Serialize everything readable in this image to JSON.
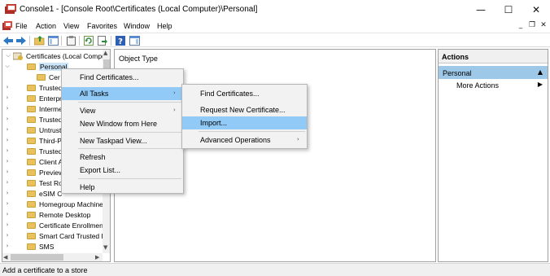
{
  "window": {
    "title": "Console1 - [Console Root\\Certificates (Local Computer)\\Personal]",
    "minimize_glyph": "—",
    "maximize_glyph": "☐",
    "close_glyph": "✕"
  },
  "menubar": {
    "items": [
      "File",
      "Action",
      "View",
      "Favorites",
      "Window",
      "Help"
    ],
    "mdi_minimize": "_",
    "mdi_restore": "❐",
    "mdi_close": "✕"
  },
  "toolbar": {
    "icons": [
      "back-arrow-icon",
      "forward-arrow-icon",
      "up-folder-icon",
      "show-hide-tree-icon",
      "clipboard-icon",
      "refresh-icon",
      "export-list-icon",
      "help-icon",
      "show-hide-action-pane-icon"
    ]
  },
  "tree": {
    "root": "Certificates (Local Compu",
    "items": [
      {
        "label": "Personal",
        "expander": "v",
        "level": 1,
        "selected": true
      },
      {
        "label": "Cer",
        "expander": "",
        "level": 2,
        "selected": false
      },
      {
        "label": "Trusted",
        "expander": ">",
        "level": 1
      },
      {
        "label": "Enterpr",
        "expander": ">",
        "level": 1
      },
      {
        "label": "Interme",
        "expander": ">",
        "level": 1
      },
      {
        "label": "Trusted",
        "expander": ">",
        "level": 1
      },
      {
        "label": "Untrust",
        "expander": ">",
        "level": 1
      },
      {
        "label": "Third-P",
        "expander": ">",
        "level": 1
      },
      {
        "label": "Trusted",
        "expander": ">",
        "level": 1
      },
      {
        "label": "Client A",
        "expander": ">",
        "level": 1
      },
      {
        "label": "Preview",
        "expander": ">",
        "level": 1
      },
      {
        "label": "Test Ro",
        "expander": ">",
        "level": 1
      },
      {
        "label": "eSIM C",
        "expander": ">",
        "level": 1
      },
      {
        "label": "Homegroup Machine",
        "expander": ">",
        "level": 1
      },
      {
        "label": "Remote Desktop",
        "expander": ">",
        "level": 1
      },
      {
        "label": "Certificate Enrollmen",
        "expander": ">",
        "level": 1
      },
      {
        "label": "Smart Card Trusted R",
        "expander": ">",
        "level": 1
      },
      {
        "label": "SMS",
        "expander": ">",
        "level": 1
      }
    ]
  },
  "center": {
    "column_header": "Object Type"
  },
  "actions": {
    "title": "Actions",
    "section": "Personal",
    "section_caret": "▲",
    "item": "More Actions",
    "item_arrow": "▶"
  },
  "context_menu": {
    "items": [
      {
        "label": "Find Certificates...",
        "submenu": false,
        "highlighted": false
      },
      {
        "label": "All Tasks",
        "submenu": true,
        "highlighted": true
      },
      {
        "label": "View",
        "submenu": true,
        "highlighted": false
      },
      {
        "label": "New Window from Here",
        "submenu": false,
        "highlighted": false
      },
      {
        "label": "New Taskpad View...",
        "submenu": false,
        "highlighted": false
      },
      {
        "label": "Refresh",
        "submenu": false,
        "highlighted": false
      },
      {
        "label": "Export List...",
        "submenu": false,
        "highlighted": false
      },
      {
        "label": "Help",
        "submenu": false,
        "highlighted": false
      }
    ]
  },
  "submenu": {
    "items": [
      {
        "label": "Find Certificates...",
        "submenu": false,
        "highlighted": false
      },
      {
        "label": "Request New Certificate...",
        "submenu": false,
        "highlighted": false
      },
      {
        "label": "Import...",
        "submenu": false,
        "highlighted": true
      },
      {
        "label": "Advanced Operations",
        "submenu": true,
        "highlighted": false
      }
    ]
  },
  "statusbar": {
    "text": "Add a certificate to a store"
  },
  "colors": {
    "highlight": "#91c9f7",
    "action_section": "#9dc8e7",
    "folder": "#e8c25d"
  }
}
